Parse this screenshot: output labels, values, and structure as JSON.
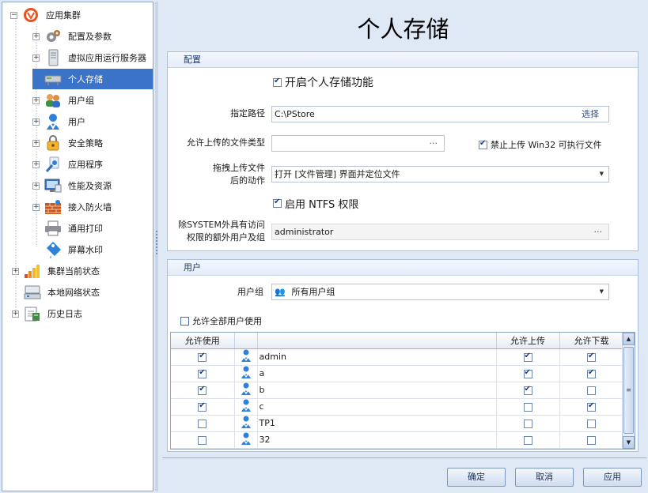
{
  "tree": {
    "root": "应用集群",
    "items": [
      {
        "label": "配置及参数",
        "icon": "gears-icon",
        "expand": "+"
      },
      {
        "label": "虚拟应用运行服务器",
        "icon": "server-icon",
        "expand": "+"
      },
      {
        "label": "个人存储",
        "icon": "storage-icon",
        "expand": "",
        "selected": true
      },
      {
        "label": "用户组",
        "icon": "user-group-icon",
        "expand": "+"
      },
      {
        "label": "用户",
        "icon": "user-icon",
        "expand": "+"
      },
      {
        "label": "安全策略",
        "icon": "lock-icon",
        "expand": "+"
      },
      {
        "label": "应用程序",
        "icon": "application-icon",
        "expand": "+"
      },
      {
        "label": "性能及资源",
        "icon": "monitor-icon",
        "expand": "+"
      },
      {
        "label": "接入防火墙",
        "icon": "firewall-icon",
        "expand": "+"
      },
      {
        "label": "通用打印",
        "icon": "printer-icon",
        "expand": ""
      },
      {
        "label": "屏幕水印",
        "icon": "watermark-tag-icon",
        "expand": ""
      }
    ],
    "top_items": [
      {
        "label": "集群当前状态",
        "icon": "bar-chart-icon",
        "expand": "+"
      },
      {
        "label": "本地网络状态",
        "icon": "network-icon",
        "expand": ""
      },
      {
        "label": "历史日志",
        "icon": "log-icon",
        "expand": "+"
      }
    ]
  },
  "page_title": "个人存储",
  "config": {
    "header": "配置",
    "enable_label": "开启个人存储功能",
    "enable_checked": true,
    "path_label": "指定路径",
    "path_value": "C:\\PStore",
    "path_button": "选择",
    "types_label": "允许上传的文件类型",
    "types_value": "",
    "types_button": "···",
    "block_win32_label": "禁止上传 Win32 可执行文件",
    "block_win32_checked": true,
    "drag_label_1": "拖拽上传文件",
    "drag_label_2": "后的动作",
    "drag_value": "打开 [文件管理] 界面并定位文件",
    "ntfs_label": "启用 NTFS 权限",
    "ntfs_checked": true,
    "extra_label_1": "除SYSTEM外具有访问",
    "extra_label_2": "权限的额外用户及组",
    "extra_value": "administrator",
    "extra_button": "···"
  },
  "users": {
    "header": "用户",
    "group_label": "用户组",
    "group_value": "所有用户组",
    "allow_all_label": "允许全部用户使用",
    "allow_all_checked": false,
    "columns": [
      "允许使用",
      "",
      "允许上传",
      "允许下载"
    ],
    "rows": [
      {
        "name": "admin",
        "use": true,
        "upload": true,
        "download": true
      },
      {
        "name": "a",
        "use": true,
        "upload": true,
        "download": true
      },
      {
        "name": "b",
        "use": true,
        "upload": true,
        "download": false
      },
      {
        "name": "c",
        "use": true,
        "upload": false,
        "download": true
      },
      {
        "name": "TP1",
        "use": false,
        "upload": false,
        "download": false
      },
      {
        "name": "32",
        "use": false,
        "upload": false,
        "download": false
      }
    ]
  },
  "buttons": {
    "ok": "确定",
    "cancel": "取消",
    "apply": "应用"
  },
  "colors": {
    "selection": "#3b73c8",
    "panel_bg": "#dfe8f5",
    "accent_header": "#1f3d6b"
  }
}
